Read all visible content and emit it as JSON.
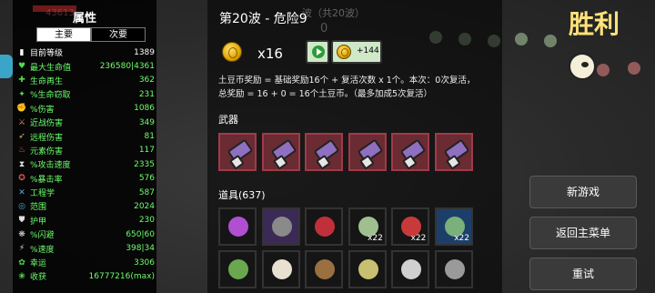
{
  "stats_panel": {
    "title": "属性",
    "ghost_text": "43613",
    "tabs": [
      {
        "label": "主要",
        "active": true
      },
      {
        "label": "次要",
        "active": false
      }
    ],
    "rows": [
      {
        "icon": "level-icon",
        "glyph": "▮",
        "color": "#ffffff",
        "label": "目前等级",
        "value": "1389",
        "label_color": "#ffffff",
        "value_color": "#ffffff"
      },
      {
        "icon": "heart-icon",
        "glyph": "♥",
        "color": "#4fdc4f",
        "label": "最大生命值",
        "value": "236580|4361",
        "label_color": "#6cff6c",
        "value_color": "#6cff6c"
      },
      {
        "icon": "regen-icon",
        "glyph": "✚",
        "color": "#4fdc4f",
        "label": "生命再生",
        "value": "362",
        "label_color": "#6cff6c",
        "value_color": "#6cff6c"
      },
      {
        "icon": "lifesteal-icon",
        "glyph": "✦",
        "color": "#4fdc4f",
        "label": "%生命窃取",
        "value": "231",
        "label_color": "#6cff6c",
        "value_color": "#6cff6c"
      },
      {
        "icon": "damage-icon",
        "glyph": "✊",
        "color": "#e05858",
        "label": "%伤害",
        "value": "1086",
        "label_color": "#6cff6c",
        "value_color": "#6cff6c"
      },
      {
        "icon": "melee-icon",
        "glyph": "⚔",
        "color": "#e08a58",
        "label": "近战伤害",
        "value": "349",
        "label_color": "#6cff6c",
        "value_color": "#6cff6c"
      },
      {
        "icon": "ranged-icon",
        "glyph": "➶",
        "color": "#e0b058",
        "label": "远程伤害",
        "value": "81",
        "label_color": "#6cff6c",
        "value_color": "#6cff6c"
      },
      {
        "icon": "elemental-icon",
        "glyph": "♨",
        "color": "#e05858",
        "label": "元素伤害",
        "value": "117",
        "label_color": "#6cff6c",
        "value_color": "#6cff6c"
      },
      {
        "icon": "attack-speed-icon",
        "glyph": "⧗",
        "color": "#e0e0e0",
        "label": "%攻击速度",
        "value": "2335",
        "label_color": "#6cff6c",
        "value_color": "#6cff6c"
      },
      {
        "icon": "crit-icon",
        "glyph": "✪",
        "color": "#e05858",
        "label": "%暴击率",
        "value": "576",
        "label_color": "#6cff6c",
        "value_color": "#6cff6c"
      },
      {
        "icon": "engineering-icon",
        "glyph": "✕",
        "color": "#58a8e0",
        "label": "工程学",
        "value": "587",
        "label_color": "#6cff6c",
        "value_color": "#6cff6c"
      },
      {
        "icon": "range-icon",
        "glyph": "◎",
        "color": "#58a8e0",
        "label": "范围",
        "value": "2024",
        "label_color": "#6cff6c",
        "value_color": "#6cff6c"
      },
      {
        "icon": "armor-icon",
        "glyph": "⛊",
        "color": "#e0e0e0",
        "label": "护甲",
        "value": "230",
        "label_color": "#6cff6c",
        "value_color": "#6cff6c"
      },
      {
        "icon": "dodge-icon",
        "glyph": "❋",
        "color": "#e0e0e0",
        "label": "%闪避",
        "value": "650|60",
        "label_color": "#6cff6c",
        "value_color": "#6cff6c"
      },
      {
        "icon": "speed-icon",
        "glyph": "⚡",
        "color": "#e0e0e0",
        "label": "%速度",
        "value": "398|34",
        "label_color": "#6cff6c",
        "value_color": "#6cff6c"
      },
      {
        "icon": "luck-icon",
        "glyph": "✿",
        "color": "#4fdc4f",
        "label": "幸运",
        "value": "3306",
        "label_color": "#6cff6c",
        "value_color": "#6cff6c"
      },
      {
        "icon": "harvest-icon",
        "glyph": "❀",
        "color": "#4fdc4f",
        "label": "收获",
        "value": "16777216(max)",
        "label_color": "#6cff6c",
        "value_color": "#6cff6c"
      }
    ]
  },
  "wave": {
    "title": "第20波 - 危险9",
    "ghost_title": "波（共20波）",
    "ghost_zero": "0"
  },
  "reward": {
    "coin_count": "x16",
    "bonus": "+144",
    "line1": "土豆币奖励 = 基础奖励16个 + 复活次数 x 1个。本次：0次复活，",
    "line2": "总奖励 = 16 + 0 = 16个土豆币。（最多加成5次复活）"
  },
  "weapons": {
    "heading": "武器",
    "count": 6
  },
  "items": {
    "heading": "道具(637)",
    "slots": [
      {
        "name": "item-purple-creature",
        "bg": "",
        "color": "#b04fd0",
        "count": ""
      },
      {
        "name": "item-dark-orb",
        "bg": "purple",
        "color": "#8a8a8a",
        "count": ""
      },
      {
        "name": "item-mask",
        "bg": "",
        "color": "#c0303a",
        "count": ""
      },
      {
        "name": "item-green-slug",
        "bg": "",
        "color": "#9fbf8f",
        "count": "x22"
      },
      {
        "name": "item-red-scissors",
        "bg": "",
        "color": "#c83a3a",
        "count": "x22"
      },
      {
        "name": "item-tea-cup",
        "bg": "blue",
        "color": "#7ab07a",
        "count": "x22"
      },
      {
        "name": "item-tree",
        "bg": "",
        "color": "#6aa84f",
        "count": ""
      },
      {
        "name": "item-coffee",
        "bg": "",
        "color": "#e8e0d0",
        "count": ""
      },
      {
        "name": "item-brown-bag",
        "bg": "",
        "color": "#9a7040",
        "count": ""
      },
      {
        "name": "item-scroll",
        "bg": "",
        "color": "#c8c070",
        "count": ""
      },
      {
        "name": "item-scythe",
        "bg": "",
        "color": "#d0d0d0",
        "count": ""
      },
      {
        "name": "item-helmet",
        "bg": "",
        "color": "#9a9a9a",
        "count": ""
      }
    ]
  },
  "victory": {
    "label": "胜利"
  },
  "buttons": {
    "new_game": "新游戏",
    "main_menu": "返回主菜单",
    "retry": "重试"
  }
}
